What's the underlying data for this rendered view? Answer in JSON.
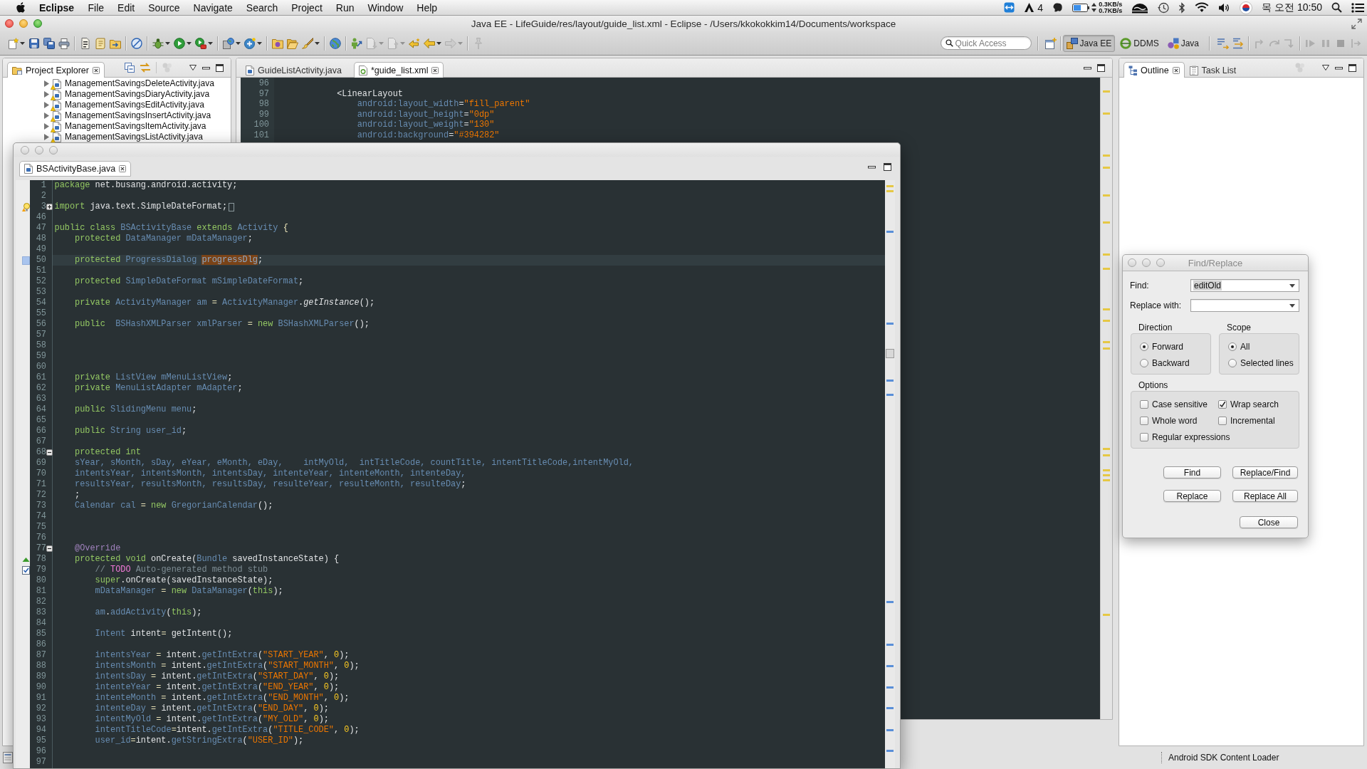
{
  "menu_bar": {
    "app_name": "Eclipse",
    "menus": [
      "File",
      "Edit",
      "Source",
      "Navigate",
      "Search",
      "Project",
      "Run",
      "Window",
      "Help"
    ],
    "status": {
      "badge_count": "4",
      "upload_rate": "0.3KB/s",
      "download_rate": "0.7KB/s",
      "clock": "목 오전 10:50"
    }
  },
  "window": {
    "title": "Java EE - LifeGuide/res/layout/guide_list.xml - Eclipse - /Users/kkokokkim14/Documents/workspace"
  },
  "toolbar": {
    "groups": [
      [
        {
          "disabled": false,
          "menu": true
        },
        {
          "disabled": false,
          "menu": false
        },
        {
          "disabled": false,
          "menu": false
        },
        {
          "disabled": false,
          "menu": false
        }
      ],
      [
        {
          "disabled": false,
          "menu": false
        },
        {
          "disabled": false,
          "menu": false
        },
        {
          "disabled": false,
          "menu": false
        }
      ],
      [
        {
          "disabled": false,
          "menu": false
        }
      ],
      [
        {
          "disabled": false,
          "menu": true
        },
        {
          "disabled": false,
          "menu": true
        },
        {
          "disabled": false,
          "menu": true
        }
      ],
      [
        {
          "disabled": false,
          "menu": true
        },
        {
          "disabled": false,
          "menu": true
        }
      ],
      [
        {
          "disabled": false,
          "menu": false
        },
        {
          "disabled": false,
          "menu": false
        },
        {
          "disabled": false,
          "menu": true
        }
      ],
      [
        {
          "disabled": false,
          "menu": false
        }
      ],
      [
        {
          "disabled": false,
          "menu": false
        },
        {
          "disabled": true,
          "menu": true
        },
        {
          "disabled": true,
          "menu": true
        },
        {
          "disabled": false,
          "menu": false
        },
        {
          "disabled": false,
          "menu": true
        },
        {
          "disabled": true,
          "menu": true
        }
      ],
      [
        {
          "disabled": true,
          "menu": false
        }
      ]
    ],
    "quick_access": {
      "placeholder": "Quick Access"
    },
    "perspectives": [
      {
        "label": "Java EE",
        "selected": true
      },
      {
        "label": "DDMS",
        "selected": false
      },
      {
        "label": "Java",
        "selected": false
      }
    ],
    "trailing_groups": [
      [
        {
          "disabled": false,
          "menu": false
        },
        {
          "disabled": false,
          "menu": false
        }
      ],
      [
        {
          "disabled": true,
          "menu": false
        },
        {
          "disabled": true,
          "menu": false
        },
        {
          "disabled": true,
          "menu": false
        }
      ],
      [
        {
          "disabled": true,
          "menu": false
        },
        {
          "disabled": true,
          "menu": false
        },
        {
          "disabled": true,
          "menu": false
        },
        {
          "disabled": true,
          "menu": false
        }
      ]
    ]
  },
  "project_explorer": {
    "tabs": [
      {
        "label": "Project Explorer",
        "selected": true
      }
    ],
    "tree": [
      {
        "label": "ManagementSavingsDeleteActivity.java",
        "expanded": false,
        "warning": true
      },
      {
        "label": "ManagementSavingsDiaryActivity.java",
        "expanded": false,
        "warning": true
      },
      {
        "label": "ManagementSavingsEditActivity.java",
        "expanded": false,
        "warning": true
      },
      {
        "label": "ManagementSavingsInsertActivity.java",
        "expanded": false,
        "warning": true
      },
      {
        "label": "ManagementSavingsItemActivity.java",
        "expanded": false,
        "warning": true
      },
      {
        "label": "ManagementSavingsListActivity.java",
        "expanded": false,
        "warning": true
      }
    ]
  },
  "editor": {
    "tabs": [
      {
        "label": "GuideListActivity.java",
        "kind": "java",
        "selected": false
      },
      {
        "label": "*guide_list.xml",
        "kind": "xml",
        "selected": true
      }
    ],
    "lines": [
      {
        "number": "96"
      },
      {
        "number": "97",
        "tokens": [
          {
            "kind": "text",
            "text": "            <LinearLayout"
          }
        ]
      },
      {
        "number": "98",
        "tokens": [
          {
            "kind": "name",
            "text": "                android:layout_width"
          },
          {
            "kind": "text",
            "text": "="
          },
          {
            "kind": "string",
            "text": "\"fill_parent\""
          }
        ]
      },
      {
        "number": "99",
        "tokens": [
          {
            "kind": "name",
            "text": "                android:layout_height"
          },
          {
            "kind": "text",
            "text": "="
          },
          {
            "kind": "string",
            "text": "\"0dp\""
          }
        ]
      },
      {
        "number": "100",
        "tokens": [
          {
            "kind": "name",
            "text": "                android:layout_weight"
          },
          {
            "kind": "text",
            "text": "="
          },
          {
            "kind": "string",
            "text": "\"130\""
          }
        ]
      },
      {
        "number": "101",
        "tokens": [
          {
            "kind": "name",
            "text": "                android:background"
          },
          {
            "kind": "text",
            "text": "="
          },
          {
            "kind": "string",
            "text": "\"#394282\""
          }
        ]
      }
    ]
  },
  "outline": {
    "tabs": [
      {
        "label": "Outline",
        "selected": true
      },
      {
        "label": "Task List",
        "selected": false
      }
    ]
  },
  "detached_editor": {
    "tabs": [
      {
        "label": "BSActivityBase.java",
        "kind": "java",
        "selected": true
      }
    ],
    "lines": [
      {
        "number": "1",
        "tokens": [
          {
            "kind": "keyword",
            "text": "package "
          },
          {
            "kind": "text",
            "text": "net.busang.android.activity;"
          }
        ]
      },
      {
        "number": "2"
      },
      {
        "number": "3",
        "marker": {
          "kind": "quick-fix"
        },
        "expanded": false,
        "tokens": [
          {
            "kind": "keyword",
            "text": "import "
          },
          {
            "kind": "text",
            "text": "java.text.SimpleDateFormat;"
          }
        ]
      },
      {
        "number": "46"
      },
      {
        "number": "47",
        "tokens": [
          {
            "kind": "keyword",
            "text": "public class "
          },
          {
            "kind": "name",
            "text": "BSActivityBase "
          },
          {
            "kind": "keyword",
            "text": "extends "
          },
          {
            "kind": "name",
            "text": "Activity "
          },
          {
            "kind": "operator",
            "text": "{"
          }
        ]
      },
      {
        "number": "48",
        "tokens": [
          {
            "kind": "keyword",
            "text": "    protected "
          },
          {
            "kind": "name",
            "text": "DataManager mDataManager"
          },
          {
            "kind": "text",
            "text": ";"
          }
        ]
      },
      {
        "number": "49"
      },
      {
        "number": "50",
        "marker": {
          "kind": "occurrence"
        },
        "current": true,
        "tokens": [
          {
            "kind": "keyword",
            "text": "    protected "
          },
          {
            "kind": "name",
            "text": "ProgressDialog "
          },
          {
            "kind": "match",
            "text": "progressDlg"
          },
          {
            "kind": "text",
            "text": ";"
          }
        ]
      },
      {
        "number": "51"
      },
      {
        "number": "52",
        "tokens": [
          {
            "kind": "keyword",
            "text": "    protected "
          },
          {
            "kind": "name",
            "text": "SimpleDateFormat mSimpleDateFormat"
          },
          {
            "kind": "text",
            "text": ";"
          }
        ]
      },
      {
        "number": "53"
      },
      {
        "number": "54",
        "tokens": [
          {
            "kind": "keyword",
            "text": "    private "
          },
          {
            "kind": "name",
            "text": "ActivityManager am "
          },
          {
            "kind": "operator",
            "text": "= "
          },
          {
            "kind": "name",
            "text": "ActivityManager"
          },
          {
            "kind": "text",
            "text": "."
          },
          {
            "kind": "static",
            "text": "getInstance"
          },
          {
            "kind": "text",
            "text": "();"
          }
        ]
      },
      {
        "number": "55"
      },
      {
        "number": "56",
        "tokens": [
          {
            "kind": "keyword",
            "text": "    public  "
          },
          {
            "kind": "name",
            "text": "BSHashXMLParser xmlParser "
          },
          {
            "kind": "operator",
            "text": "= "
          },
          {
            "kind": "keyword",
            "text": "new "
          },
          {
            "kind": "name",
            "text": "BSHashXMLParser"
          },
          {
            "kind": "text",
            "text": "();"
          }
        ]
      },
      {
        "number": "57"
      },
      {
        "number": "58"
      },
      {
        "number": "59"
      },
      {
        "number": "60"
      },
      {
        "number": "61",
        "tokens": [
          {
            "kind": "keyword",
            "text": "    private "
          },
          {
            "kind": "name",
            "text": "ListView mMenuListView"
          },
          {
            "kind": "text",
            "text": ";"
          }
        ]
      },
      {
        "number": "62",
        "tokens": [
          {
            "kind": "keyword",
            "text": "    private "
          },
          {
            "kind": "name",
            "text": "MenuListAdapter mAdapter"
          },
          {
            "kind": "text",
            "text": ";"
          }
        ]
      },
      {
        "number": "63"
      },
      {
        "number": "64",
        "tokens": [
          {
            "kind": "keyword",
            "text": "    public "
          },
          {
            "kind": "name",
            "text": "SlidingMenu menu"
          },
          {
            "kind": "text",
            "text": ";"
          }
        ]
      },
      {
        "number": "65"
      },
      {
        "number": "66",
        "tokens": [
          {
            "kind": "keyword",
            "text": "    public "
          },
          {
            "kind": "name",
            "text": "String user_id"
          },
          {
            "kind": "text",
            "text": ";"
          }
        ]
      },
      {
        "number": "67"
      },
      {
        "number": "68",
        "expanded": true,
        "tokens": [
          {
            "kind": "keyword",
            "text": "    protected int"
          }
        ]
      },
      {
        "number": "69",
        "tokens": [
          {
            "kind": "name",
            "text": "    sYear, sMonth, sDay, eYear, eMonth, eDay,    intMyOld,  intTitleCode, countTitle, intentTitleCode,intentMyOld,"
          }
        ]
      },
      {
        "number": "70",
        "tokens": [
          {
            "kind": "name",
            "text": "    intentsYear, intentsMonth, intentsDay, intenteYear, intenteMonth, intenteDay,"
          }
        ]
      },
      {
        "number": "71",
        "tokens": [
          {
            "kind": "name",
            "text": "    resultsYear, resultsMonth, resultsDay, resulteYear, resulteMonth, resulteDay"
          },
          {
            "kind": "text",
            "text": ";"
          }
        ]
      },
      {
        "number": "72",
        "tokens": [
          {
            "kind": "text",
            "text": "    ;"
          }
        ]
      },
      {
        "number": "73",
        "tokens": [
          {
            "kind": "name",
            "text": "    Calendar cal "
          },
          {
            "kind": "operator",
            "text": "= "
          },
          {
            "kind": "keyword",
            "text": "new "
          },
          {
            "kind": "name",
            "text": "GregorianCalendar"
          },
          {
            "kind": "text",
            "text": "();"
          }
        ]
      },
      {
        "number": "74"
      },
      {
        "number": "75"
      },
      {
        "number": "76"
      },
      {
        "number": "77",
        "expanded": true,
        "tokens": [
          {
            "kind": "annotation",
            "text": "    @Override"
          }
        ]
      },
      {
        "number": "78",
        "marker": {
          "kind": "override"
        },
        "tokens": [
          {
            "kind": "keyword",
            "text": "    protected void "
          },
          {
            "kind": "text",
            "text": "onCreate("
          },
          {
            "kind": "name",
            "text": "Bundle "
          },
          {
            "kind": "text",
            "text": "savedInstanceState) {"
          }
        ]
      },
      {
        "number": "79",
        "marker": {
          "kind": "task"
        },
        "tokens": [
          {
            "kind": "comment",
            "text": "        // "
          },
          {
            "kind": "task",
            "text": "TODO"
          },
          {
            "kind": "comment",
            "text": " Auto-generated method stub"
          }
        ]
      },
      {
        "number": "80",
        "tokens": [
          {
            "kind": "keyword",
            "text": "        super"
          },
          {
            "kind": "text",
            "text": ".onCreate(savedInstanceState);"
          }
        ]
      },
      {
        "number": "81",
        "tokens": [
          {
            "kind": "name",
            "text": "        mDataManager "
          },
          {
            "kind": "operator",
            "text": "= "
          },
          {
            "kind": "keyword",
            "text": "new "
          },
          {
            "kind": "name",
            "text": "DataManager"
          },
          {
            "kind": "text",
            "text": "("
          },
          {
            "kind": "keyword",
            "text": "this"
          },
          {
            "kind": "text",
            "text": ");"
          }
        ]
      },
      {
        "number": "82"
      },
      {
        "number": "83",
        "tokens": [
          {
            "kind": "name",
            "text": "        am"
          },
          {
            "kind": "text",
            "text": "."
          },
          {
            "kind": "name",
            "text": "addActivity"
          },
          {
            "kind": "text",
            "text": "("
          },
          {
            "kind": "keyword",
            "text": "this"
          },
          {
            "kind": "text",
            "text": ");"
          }
        ]
      },
      {
        "number": "84"
      },
      {
        "number": "85",
        "tokens": [
          {
            "kind": "name",
            "text": "        Intent "
          },
          {
            "kind": "text",
            "text": "intent"
          },
          {
            "kind": "operator",
            "text": "= "
          },
          {
            "kind": "text",
            "text": "getIntent();"
          }
        ]
      },
      {
        "number": "86"
      },
      {
        "number": "87",
        "tokens": [
          {
            "kind": "name",
            "text": "        intentsYear "
          },
          {
            "kind": "operator",
            "text": "= "
          },
          {
            "kind": "text",
            "text": "intent."
          },
          {
            "kind": "name",
            "text": "getIntExtra"
          },
          {
            "kind": "text",
            "text": "("
          },
          {
            "kind": "string",
            "text": "\"START_YEAR\""
          },
          {
            "kind": "text",
            "text": ", "
          },
          {
            "kind": "number",
            "text": "0"
          },
          {
            "kind": "text",
            "text": ");"
          }
        ]
      },
      {
        "number": "88",
        "tokens": [
          {
            "kind": "name",
            "text": "        intentsMonth "
          },
          {
            "kind": "operator",
            "text": "= "
          },
          {
            "kind": "text",
            "text": "intent."
          },
          {
            "kind": "name",
            "text": "getIntExtra"
          },
          {
            "kind": "text",
            "text": "("
          },
          {
            "kind": "string",
            "text": "\"START_MONTH\""
          },
          {
            "kind": "text",
            "text": ", "
          },
          {
            "kind": "number",
            "text": "0"
          },
          {
            "kind": "text",
            "text": ");"
          }
        ]
      },
      {
        "number": "89",
        "tokens": [
          {
            "kind": "name",
            "text": "        intentsDay "
          },
          {
            "kind": "operator",
            "text": "= "
          },
          {
            "kind": "text",
            "text": "intent."
          },
          {
            "kind": "name",
            "text": "getIntExtra"
          },
          {
            "kind": "text",
            "text": "("
          },
          {
            "kind": "string",
            "text": "\"START_DAY\""
          },
          {
            "kind": "text",
            "text": ", "
          },
          {
            "kind": "number",
            "text": "0"
          },
          {
            "kind": "text",
            "text": ");"
          }
        ]
      },
      {
        "number": "90",
        "tokens": [
          {
            "kind": "name",
            "text": "        intenteYear "
          },
          {
            "kind": "operator",
            "text": "= "
          },
          {
            "kind": "text",
            "text": "intent."
          },
          {
            "kind": "name",
            "text": "getIntExtra"
          },
          {
            "kind": "text",
            "text": "("
          },
          {
            "kind": "string",
            "text": "\"END_YEAR\""
          },
          {
            "kind": "text",
            "text": ", "
          },
          {
            "kind": "number",
            "text": "0"
          },
          {
            "kind": "text",
            "text": ");"
          }
        ]
      },
      {
        "number": "91",
        "tokens": [
          {
            "kind": "name",
            "text": "        intenteMonth "
          },
          {
            "kind": "operator",
            "text": "= "
          },
          {
            "kind": "text",
            "text": "intent."
          },
          {
            "kind": "name",
            "text": "getIntExtra"
          },
          {
            "kind": "text",
            "text": "("
          },
          {
            "kind": "string",
            "text": "\"END_MONTH\""
          },
          {
            "kind": "text",
            "text": ", "
          },
          {
            "kind": "number",
            "text": "0"
          },
          {
            "kind": "text",
            "text": ");"
          }
        ]
      },
      {
        "number": "92",
        "tokens": [
          {
            "kind": "name",
            "text": "        intenteDay "
          },
          {
            "kind": "operator",
            "text": "= "
          },
          {
            "kind": "text",
            "text": "intent."
          },
          {
            "kind": "name",
            "text": "getIntExtra"
          },
          {
            "kind": "text",
            "text": "("
          },
          {
            "kind": "string",
            "text": "\"END_DAY\""
          },
          {
            "kind": "text",
            "text": ", "
          },
          {
            "kind": "number",
            "text": "0"
          },
          {
            "kind": "text",
            "text": ");"
          }
        ]
      },
      {
        "number": "93",
        "tokens": [
          {
            "kind": "name",
            "text": "        intentMyOld "
          },
          {
            "kind": "operator",
            "text": "= "
          },
          {
            "kind": "text",
            "text": "intent."
          },
          {
            "kind": "name",
            "text": "getIntExtra"
          },
          {
            "kind": "text",
            "text": "("
          },
          {
            "kind": "string",
            "text": "\"MY_OLD\""
          },
          {
            "kind": "text",
            "text": ", "
          },
          {
            "kind": "number",
            "text": "0"
          },
          {
            "kind": "text",
            "text": ");"
          }
        ]
      },
      {
        "number": "94",
        "tokens": [
          {
            "kind": "name",
            "text": "        intentTitleCode"
          },
          {
            "kind": "operator",
            "text": "="
          },
          {
            "kind": "text",
            "text": "intent."
          },
          {
            "kind": "name",
            "text": "getIntExtra"
          },
          {
            "kind": "text",
            "text": "("
          },
          {
            "kind": "string",
            "text": "\"TITLE_CODE\""
          },
          {
            "kind": "text",
            "text": ", "
          },
          {
            "kind": "number",
            "text": "0"
          },
          {
            "kind": "text",
            "text": ");"
          }
        ]
      },
      {
        "number": "95",
        "tokens": [
          {
            "kind": "name",
            "text": "        user_id"
          },
          {
            "kind": "operator",
            "text": "="
          },
          {
            "kind": "text",
            "text": "intent."
          },
          {
            "kind": "name",
            "text": "getStringExtra"
          },
          {
            "kind": "text",
            "text": "("
          },
          {
            "kind": "string",
            "text": "\"USER_ID\""
          },
          {
            "kind": "text",
            "text": ");"
          }
        ]
      },
      {
        "number": "96"
      },
      {
        "number": "97"
      }
    ]
  },
  "find_replace": {
    "title": "Find/Replace",
    "find": {
      "label": "Find:",
      "value": "editOld",
      "value_selected": true
    },
    "replace": {
      "label": "Replace with:"
    },
    "direction": {
      "title": "Direction",
      "options": [
        {
          "label": "Forward",
          "selected": true
        },
        {
          "label": "Backward",
          "selected": false
        }
      ]
    },
    "scope": {
      "title": "Scope",
      "options": [
        {
          "label": "All",
          "selected": true
        },
        {
          "label": "Selected lines",
          "selected": false
        }
      ]
    },
    "options": {
      "title": "Options",
      "items": [
        {
          "label": "Case sensitive",
          "checked": false
        },
        {
          "label": "Wrap search",
          "checked": true
        },
        {
          "label": "Whole word",
          "checked": false
        },
        {
          "label": "Incremental",
          "checked": false
        },
        {
          "label": "Regular expressions",
          "checked": false
        }
      ]
    },
    "buttons": [
      "Find",
      "Replace/Find",
      "Replace",
      "Replace All",
      "Close"
    ]
  },
  "status_bar": {
    "message": "Android SDK Content Loader"
  }
}
